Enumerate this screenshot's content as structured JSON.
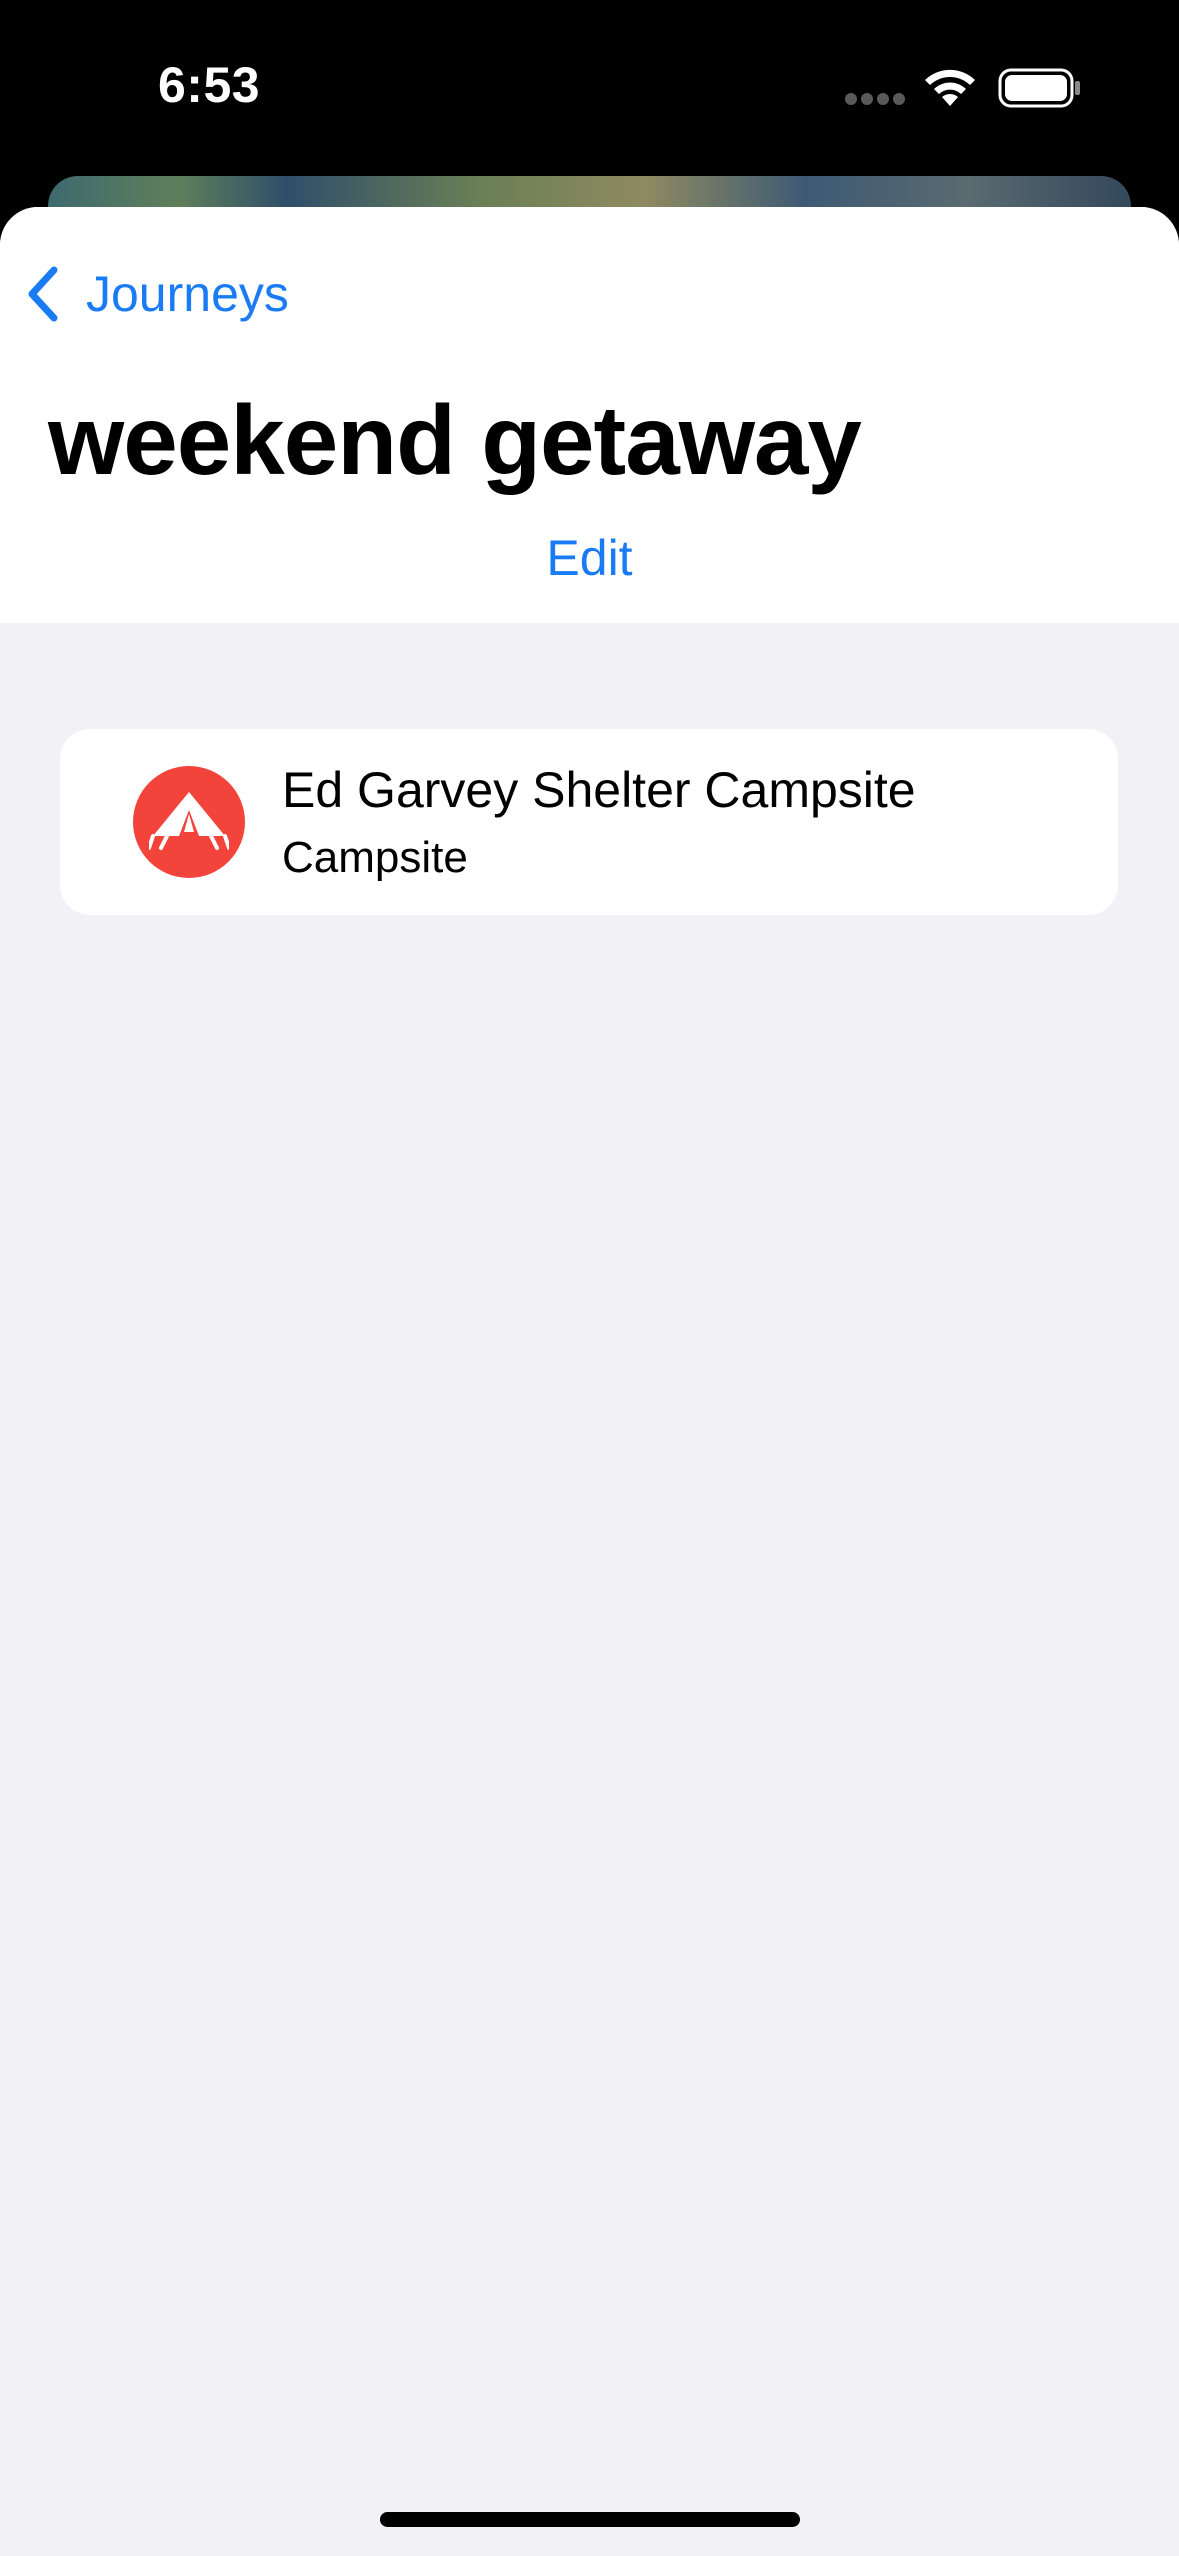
{
  "status_bar": {
    "time": "6:53"
  },
  "navigation": {
    "back_label": "Journeys",
    "back_icon": "chevron-left-icon"
  },
  "journey": {
    "title": "weekend getaway",
    "edit_label": "Edit"
  },
  "places": [
    {
      "name": "Ed Garvey Shelter Campsite",
      "type": "Campsite",
      "icon": "tent-icon",
      "icon_color": "#f2443b"
    }
  ],
  "colors": {
    "accent": "#1a7cf5",
    "background": "#f1f1f6",
    "campsite": "#f2443b"
  }
}
